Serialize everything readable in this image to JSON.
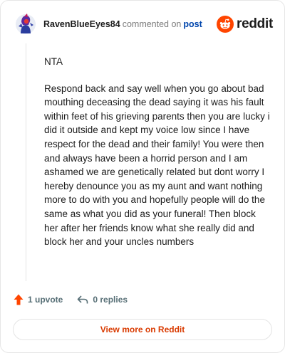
{
  "header": {
    "username": "RavenBlueEyes84",
    "action_text": "commented on",
    "post_link": "post",
    "brand_text": "reddit"
  },
  "comment": {
    "verdict": "NTA",
    "body": "Respond back and say well when you go about bad mouthing deceasing the dead saying it was his fault within feet of his grieving parents then you are lucky i did it outside and kept my voice low since I have respect for the dead and their family! You were then and always have been a horrid person and I am ashamed we are genetically related but dont worry I hereby denounce you as my aunt and want nothing more to do with you and hopefully people will do the same as what you did as your funeral! Then block her after her friends know what she really did and block her and your uncles numbers"
  },
  "actions": {
    "upvote_label": "1 upvote",
    "reply_label": "0 replies"
  },
  "footer": {
    "view_more_label": "View more on Reddit"
  },
  "colors": {
    "brand_orange": "#ff4500",
    "upvote_orange": "#ff4500",
    "link_blue": "#0045ac",
    "view_more_text": "#d93a00"
  },
  "icons": {
    "avatar": "user-avatar",
    "brand": "reddit-snoo-icon",
    "upvote": "upvote-arrow-icon",
    "reply": "reply-arrow-icon"
  }
}
